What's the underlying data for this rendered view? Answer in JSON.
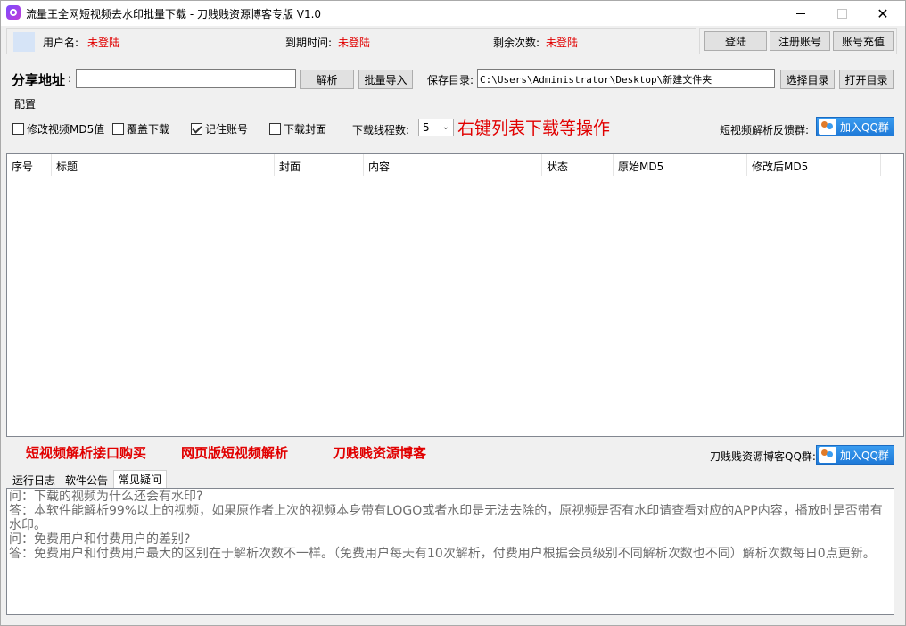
{
  "window": {
    "title": "流量王全网短视频去水印批量下载 - 刀贱贱资源博客专版  V1.0",
    "icons": {
      "app": "app-logo-icon",
      "minimize": "minimize-icon",
      "maximize": "maximize-icon",
      "close": "close-icon"
    },
    "close_glyph": "✕"
  },
  "user": {
    "username_label": "用户名:",
    "username_value": "未登陆",
    "expiry_label": "到期时间:",
    "expiry_value": "未登陆",
    "remaining_label": "剩余次数:",
    "remaining_value": "未登陆",
    "value_color": "#e10000"
  },
  "account_buttons": {
    "login": "登陆",
    "register": "注册账号",
    "recharge": "账号充值"
  },
  "share": {
    "label": "分享地址",
    "colon": ":",
    "url_value": "",
    "parse_button": "解析",
    "batch_import_button": "批量导入",
    "save_dir_label": "保存目录:",
    "save_dir_value": "C:\\Users\\Administrator\\Desktop\\新建文件夹",
    "choose_dir_button": "选择目录",
    "open_dir_button": "打开目录"
  },
  "config": {
    "group_title": "配置",
    "checkboxes": [
      {
        "label": "修改视频MD5值",
        "checked": false
      },
      {
        "label": "覆盖下载",
        "checked": false
      },
      {
        "label": "记住账号",
        "checked": true
      },
      {
        "label": "下载封面",
        "checked": false
      }
    ],
    "threads_label": "下载线程数:",
    "threads_value": "5",
    "chevron_glyph": "⌄",
    "hint": "右键列表下载等操作",
    "feedback_label": "短视频解析反馈群:",
    "qq_button": "加入QQ群",
    "accent": "#e10000"
  },
  "table": {
    "columns": [
      "序号",
      "标题",
      "封面",
      "内容",
      "状态",
      "原始MD5",
      "修改后MD5"
    ],
    "rows": []
  },
  "links": {
    "api_purchase": "短视频解析接口购买",
    "web_parse": "网页版短视频解析",
    "blog": "刀贱贱资源博客",
    "blog_qq_label": "刀贱贱资源博客QQ群:",
    "qq_button": "加入QQ群"
  },
  "tabs": [
    {
      "label": "运行日志",
      "active": false
    },
    {
      "label": "软件公告",
      "active": false
    },
    {
      "label": "常见疑问",
      "active": true
    }
  ],
  "faq": [
    "问：下载的视频为什么还会有水印?",
    "答：本软件能解析99%以上的视频，如果原作者上次的视频本身带有LOGO或者水印是无法去除的，原视频是否有水印请查看对应的APP内容，播放时是否带有水印。",
    "问：免费用户和付费用户的差别?",
    "答：免费用户和付费用户最大的区别在于解析次数不一样。（免费用户每天有10次解析，付费用户根据会员级别不同解析次数也不同）解析次数每日0点更新。"
  ]
}
